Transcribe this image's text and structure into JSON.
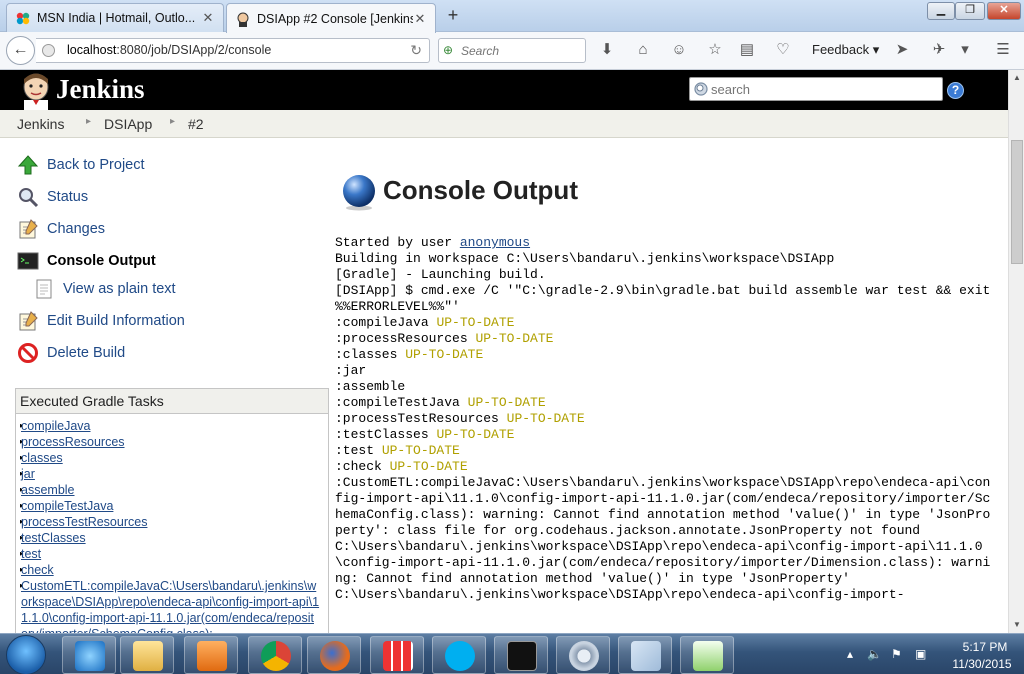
{
  "browser": {
    "tabs": [
      {
        "label": "MSN India | Hotmail, Outlo...",
        "active": false
      },
      {
        "label": "DSIApp #2 Console [Jenkins]",
        "active": true
      }
    ],
    "url_host": "localhost",
    "url_path": ":8080/job/DSIApp/2/console",
    "search_placeholder": "Search",
    "feedback_label": "Feedback"
  },
  "jenkins": {
    "title": "Jenkins",
    "search_placeholder": "search",
    "help_label": "?"
  },
  "breadcrumb": [
    "Jenkins",
    "DSIApp",
    "#2"
  ],
  "sidebar": {
    "tasks": [
      {
        "label": "Back to Project"
      },
      {
        "label": "Status"
      },
      {
        "label": "Changes"
      },
      {
        "label": "Console Output"
      },
      {
        "label": "View as plain text"
      },
      {
        "label": "Edit Build Information"
      },
      {
        "label": "Delete Build"
      }
    ],
    "gradle_title": "Executed Gradle Tasks",
    "gradle_tasks": [
      "compileJava",
      "processResources",
      "classes",
      "jar",
      "assemble",
      "compileTestJava",
      "processTestResources",
      "testClasses",
      "test",
      "check",
      "CustomETL:compileJavaC:\\Users\\bandaru\\.jenkins\\workspace\\DSIApp\\repo\\endeca-api\\config-import-api\\11.1.0\\config-import-api-11.1.0.jar(com/endeca/repository/importer/SchemaConfig.class):"
    ]
  },
  "main": {
    "title": "Console Output",
    "console": {
      "started_prefix": "Started by user ",
      "started_user": "anonymous",
      "line_workspace": "Building in workspace C:\\Users\\bandaru\\.jenkins\\workspace\\DSIApp",
      "line_gradle": "[Gradle] - Launching build.",
      "line_cmd": "[DSIApp] $ cmd.exe /C '\"C:\\gradle-2.9\\bin\\gradle.bat build assemble war test && exit %%ERRORLEVEL%%\"'",
      "tasks": [
        {
          "name": ":compileJava",
          "status": "UP-TO-DATE"
        },
        {
          "name": ":processResources",
          "status": "UP-TO-DATE"
        },
        {
          "name": ":classes",
          "status": "UP-TO-DATE"
        },
        {
          "name": ":jar",
          "status": ""
        },
        {
          "name": ":assemble",
          "status": ""
        },
        {
          "name": ":compileTestJava",
          "status": "UP-TO-DATE"
        },
        {
          "name": ":processTestResources",
          "status": "UP-TO-DATE"
        },
        {
          "name": ":testClasses",
          "status": "UP-TO-DATE"
        },
        {
          "name": ":test",
          "status": "UP-TO-DATE"
        },
        {
          "name": ":check",
          "status": "UP-TO-DATE"
        }
      ],
      "warnings": [
        ":CustomETL:compileJavaC:\\Users\\bandaru\\.jenkins\\workspace\\DSIApp\\repo\\endeca-api\\config-import-api\\11.1.0\\config-import-api-11.1.0.jar(com/endeca/repository/importer/SchemaConfig.class): warning: Cannot find annotation method 'value()' in type 'JsonProperty': class file for org.codehaus.jackson.annotate.JsonProperty not found",
        "C:\\Users\\bandaru\\.jenkins\\workspace\\DSIApp\\repo\\endeca-api\\config-import-api\\11.1.0\\config-import-api-11.1.0.jar(com/endeca/repository/importer/Dimension.class): warning: Cannot find annotation method 'value()' in type 'JsonProperty'",
        "C:\\Users\\bandaru\\.jenkins\\workspace\\DSIApp\\repo\\endeca-api\\config-import-"
      ]
    }
  },
  "taskbar": {
    "time": "5:17 PM",
    "date": "11/30/2015"
  },
  "colors": {
    "jenkins_header": "#000000",
    "link": "#204a87",
    "uptodate": "#b0a000"
  }
}
